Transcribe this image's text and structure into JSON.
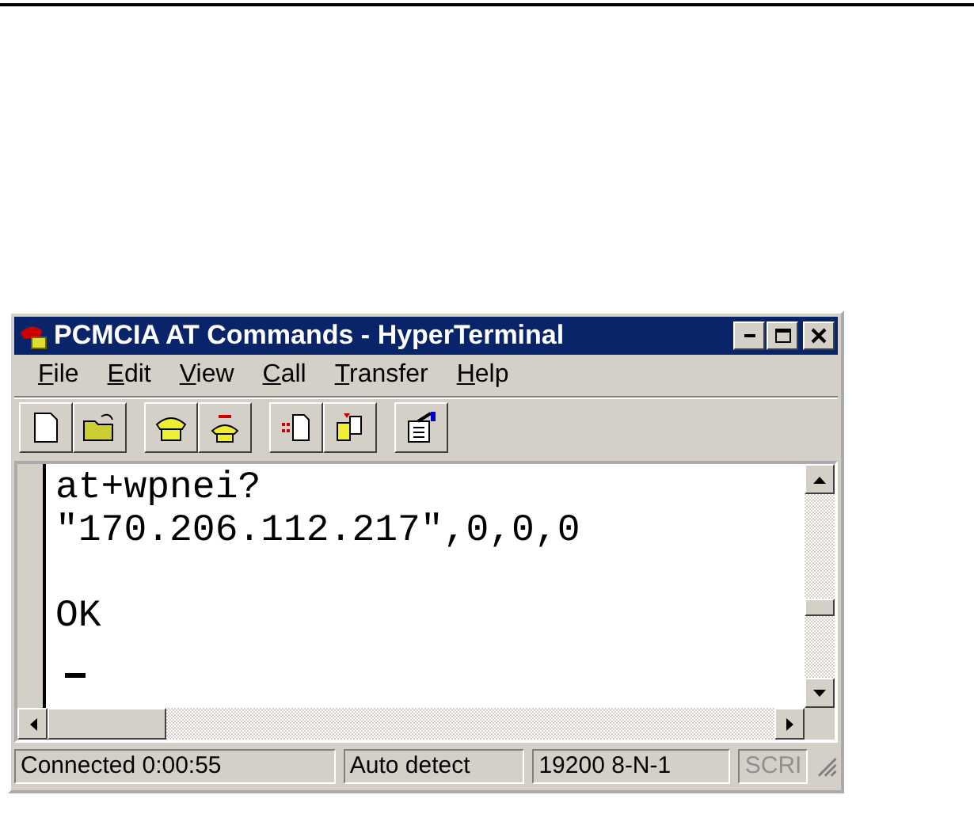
{
  "window": {
    "title": "PCMCIA AT Commands - HyperTerminal"
  },
  "menu": [
    {
      "label": "File"
    },
    {
      "label": "Edit"
    },
    {
      "label": "View"
    },
    {
      "label": "Call"
    },
    {
      "label": "Transfer"
    },
    {
      "label": "Help"
    }
  ],
  "terminal": {
    "blocks": [
      [
        "at+wpnei?",
        "\"170.206.112.217\",0,0,0"
      ],
      [
        "OK"
      ]
    ],
    "cursor_visible": true
  },
  "status_bar": [
    {
      "text": "Connected 0:00:55",
      "disabled": false
    },
    {
      "text": "Auto detect",
      "disabled": false
    },
    {
      "text": "19200 8-N-1",
      "disabled": false
    },
    {
      "text": "SCRI",
      "disabled": true
    }
  ]
}
